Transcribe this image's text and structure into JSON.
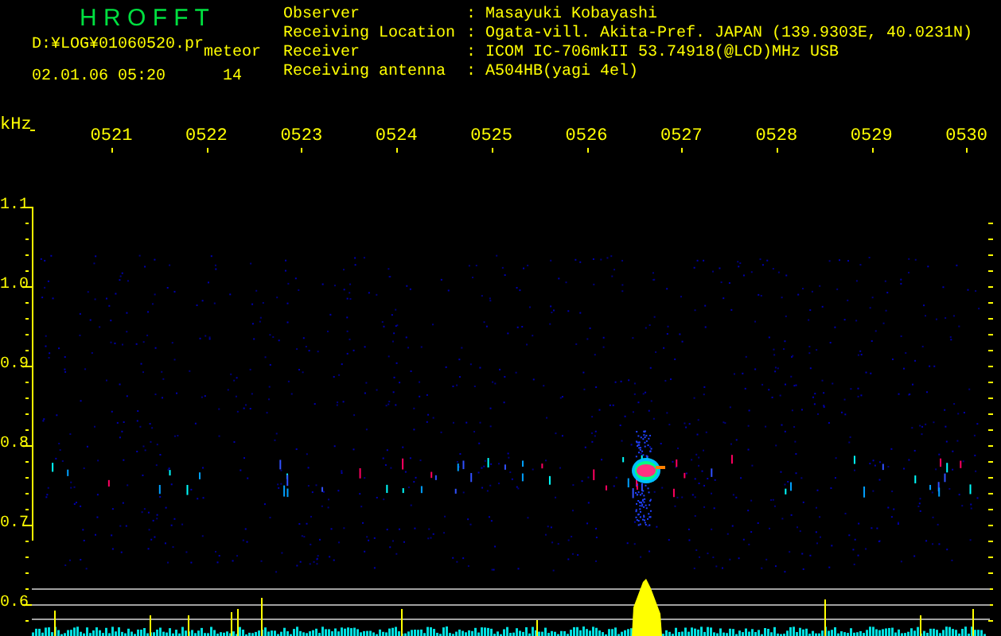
{
  "app_title": "H R O F F T",
  "file_path": "D:¥LOG¥01060520.pr",
  "mode_label": "meteor",
  "datetime": "02.01.06 05:20",
  "count": "14",
  "info": [
    {
      "label": "Observer",
      "separator": ":",
      "value": "Masayuki Kobayashi"
    },
    {
      "label": "Receiving Location",
      "separator": ":",
      "value": "Ogata-vill. Akita-Pref. JAPAN (139.9303E, 40.0231N)"
    },
    {
      "label": "Receiver",
      "separator": ":",
      "value": "ICOM IC-706mkII 53.74918(@LCD)MHz USB"
    },
    {
      "label": "Receiving antenna",
      "separator": ":",
      "value": "A504HB(yagi 4el)"
    }
  ],
  "freq_unit": "kHz",
  "time_ticks": [
    "0521",
    "0522",
    "0523",
    "0524",
    "0525",
    "0526",
    "0527",
    "0528",
    "0529",
    "0530"
  ],
  "freq_ticks": [
    "1.1",
    "1.0",
    "0.9",
    "0.8",
    "0.7",
    "0.6"
  ]
}
